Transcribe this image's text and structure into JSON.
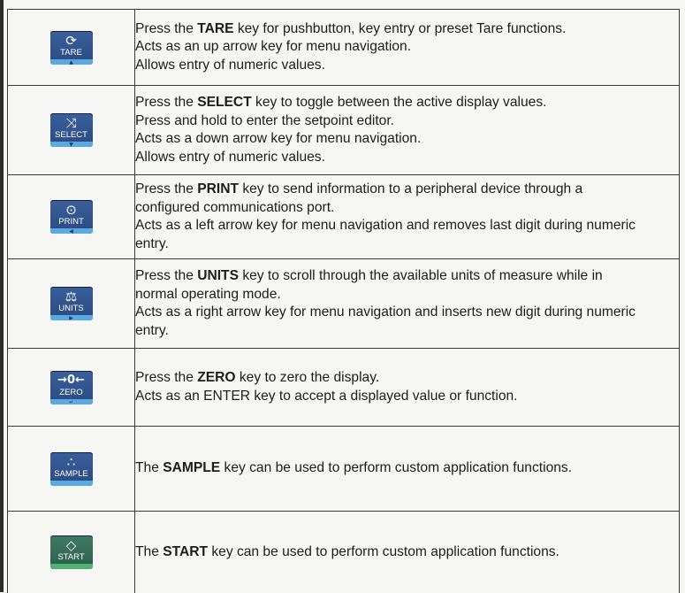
{
  "rows": [
    {
      "key": {
        "label": "TARE",
        "glyph": "⟳",
        "glyph_name": "tare-icon",
        "nav": "▲",
        "color": "#2f5590"
      },
      "lines": [
        {
          "pre": "Press the ",
          "kw": "TARE",
          "post": " key for pushbutton, key entry or preset Tare functions."
        },
        {
          "text": "Acts as an up arrow key for menu navigation."
        },
        {
          "text": "Allows entry of numeric values."
        }
      ]
    },
    {
      "key": {
        "label": "SELECT",
        "glyph": "⤨",
        "glyph_name": "select-icon",
        "nav": "▼",
        "color": "#2f5590"
      },
      "lines": [
        {
          "pre": "Press the ",
          "kw": "SELECT",
          "post": " key to toggle between the active display values."
        },
        {
          "text": "Press and hold to enter the setpoint editor."
        },
        {
          "text": "Acts as a down arrow key for menu navigation."
        },
        {
          "text": "Allows entry of numeric values."
        }
      ]
    },
    {
      "key": {
        "label": "PRINT",
        "glyph": "⊙",
        "glyph_name": "print-icon",
        "nav": "◀",
        "color": "#2f5590"
      },
      "lines": [
        {
          "pre": "Press the ",
          "kw": "PRINT",
          "post": " key to send information to a peripheral device through a"
        },
        {
          "text": "configured communications port."
        },
        {
          "text": "Acts as a left arrow key for menu navigation and removes last digit during numeric"
        },
        {
          "text": "entry."
        }
      ]
    },
    {
      "key": {
        "label": "UNITS",
        "glyph": "⚖",
        "glyph_name": "units-icon",
        "nav": "▶",
        "color": "#2f5590"
      },
      "lines": [
        {
          "pre": "Press the ",
          "kw": "UNITS",
          "post": " key to scroll through the available units of measure while in"
        },
        {
          "text": "normal operating mode."
        },
        {
          "text": "Acts as a right arrow key for menu navigation and inserts new digit during numeric"
        },
        {
          "text": "entry."
        }
      ]
    },
    {
      "key": {
        "label": "ZERO",
        "glyph": "→0←",
        "glyph_name": "zero-icon",
        "nav": "↵",
        "color": "#2f5590"
      },
      "lines": [
        {
          "pre": "Press the ",
          "kw": "ZERO",
          "post": " key to zero the display."
        },
        {
          "text": "Acts as an ENTER key to accept a displayed value or function."
        }
      ]
    },
    {
      "key": {
        "label": "SAMPLE",
        "glyph": "∴",
        "glyph_name": "sample-icon",
        "nav": "",
        "color": "#2f5590"
      },
      "lines": [
        {
          "pre": "The ",
          "kw": "SAMPLE",
          "post": " key can be used to perform custom application functions."
        }
      ]
    },
    {
      "key": {
        "label": "START",
        "glyph": "◇",
        "glyph_name": "start-icon",
        "nav": "",
        "color": "#3a7460"
      },
      "lines": [
        {
          "pre": "The ",
          "kw": "START",
          "post": " key can be used to perform custom application functions."
        }
      ]
    }
  ]
}
